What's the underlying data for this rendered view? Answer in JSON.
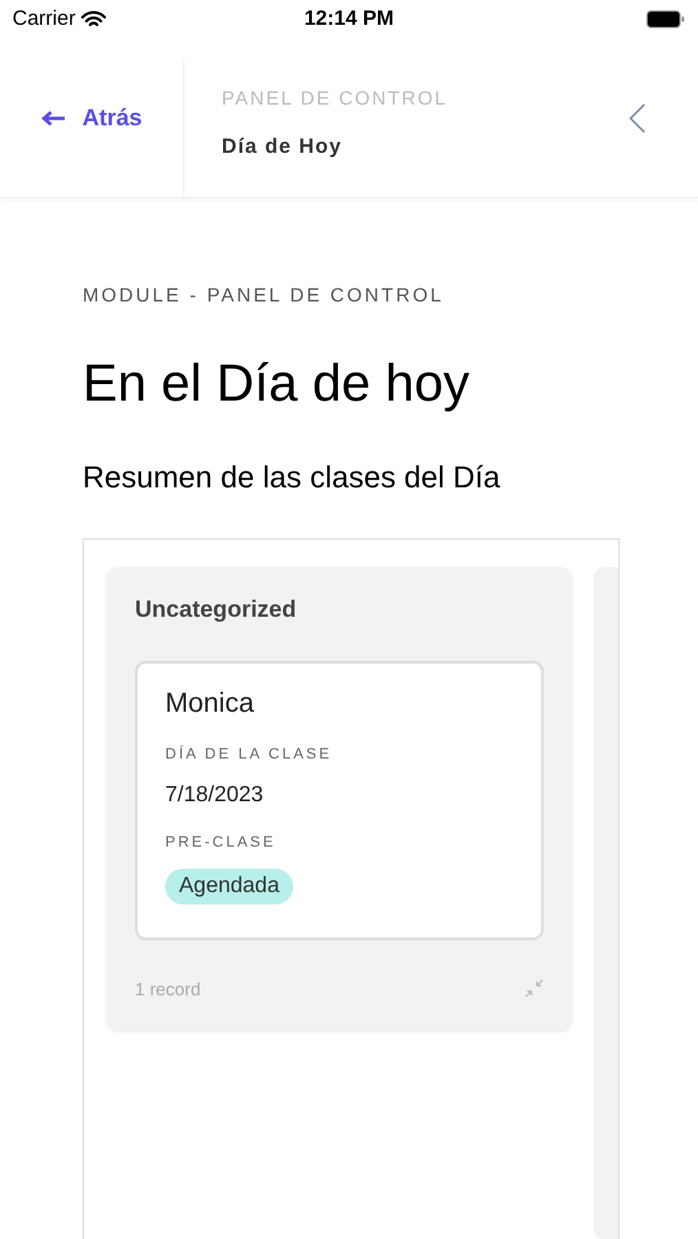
{
  "status_bar": {
    "carrier": "Carrier",
    "time": "12:14 PM"
  },
  "header": {
    "back_label": "Atrás",
    "section": "PANEL DE CONTROL",
    "title": "Día de Hoy"
  },
  "page": {
    "eyebrow": "MODULE - PANEL DE CONTROL",
    "heading": "En el Día de hoy",
    "subheading": "Resumen de las clases del Día"
  },
  "board": {
    "columns": [
      {
        "title": "Uncategorized",
        "footer": "1 record",
        "cards": [
          {
            "title": "Monica",
            "fields": [
              {
                "kind": "text",
                "label": "DÍA DE LA CLASE",
                "value": "7/18/2023"
              },
              {
                "kind": "tag",
                "label": "PRE-CLASE",
                "value": "Agendada"
              }
            ]
          }
        ]
      }
    ]
  }
}
